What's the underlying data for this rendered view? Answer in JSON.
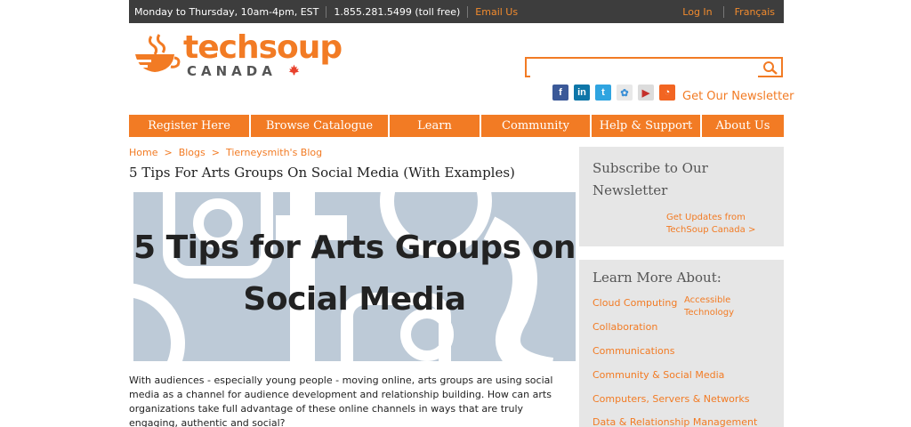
{
  "topbar": {
    "hours": "Monday to Thursday, 10am-4pm, EST",
    "phone": "1.855.281.5499 (toll free)",
    "email": "Email Us",
    "login": "Log In",
    "lang": "Français"
  },
  "logo": {
    "word": "techsoup",
    "sub": "CANADA"
  },
  "search": {
    "placeholder": ""
  },
  "social": {
    "newsletter": "Get Our Newsletter"
  },
  "nav": [
    "Register Here",
    "Browse Catalogue",
    "Learn",
    "Community",
    "Help & Support",
    "About Us"
  ],
  "breadcrumb": [
    "Home",
    "Blogs",
    "Tierneysmith's Blog"
  ],
  "article": {
    "title": "5 Tips For Arts Groups On Social Media (With Examples)",
    "hero_line1": "5 Tips for Arts Groups on",
    "hero_line2": "Social Media",
    "intro": "With audiences - especially young people - moving online, arts groups are using social media as a channel for audience development and relationship building. How can arts organizations take full advantage of these online channels in ways  that are truly engaging, authentic and social?"
  },
  "subscribe": {
    "heading": "Subscribe to Our Newsletter",
    "link": "Get Updates from TechSoup Canada >"
  },
  "learn": {
    "heading": "Learn More About:",
    "items": [
      "Cloud Computing",
      "Collaboration",
      "Communications",
      "Community & Social Media",
      "Computers, Servers & Networks",
      "Data & Relationship Management"
    ],
    "accessible": "Accessible Technology"
  },
  "colors": {
    "brand": "#f27b24",
    "topbar": "#3d3d3d",
    "panel": "#e6e6e6",
    "hero": "#bdcad7"
  }
}
